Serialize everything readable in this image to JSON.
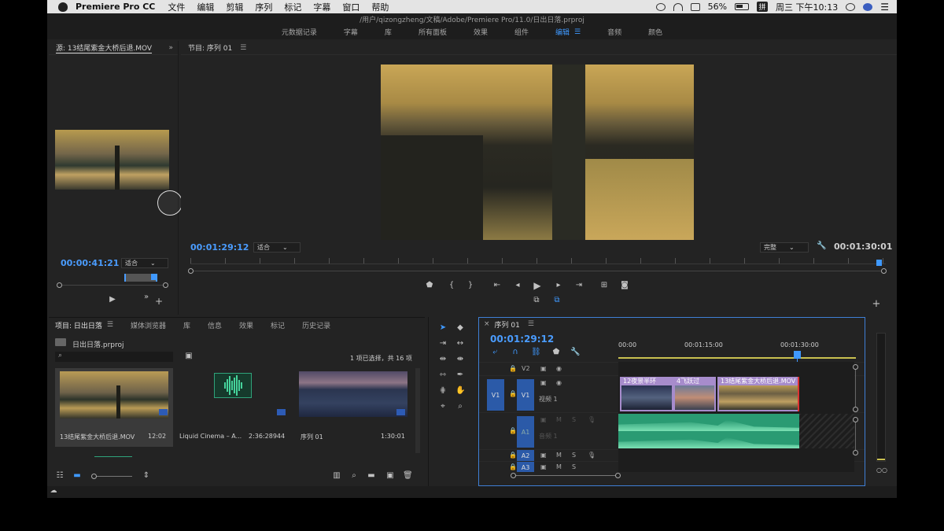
{
  "menubar": {
    "app_name": "Premiere Pro CC",
    "items": [
      "文件",
      "编辑",
      "剪辑",
      "序列",
      "标记",
      "字幕",
      "窗口",
      "帮助"
    ],
    "battery": "56%",
    "input_method": "拼",
    "clock": "周三 下午10:13"
  },
  "window": {
    "title": "/用户/qizongzheng/文稿/Adobe/Premiere Pro/11.0/日出日落.prproj"
  },
  "workspaces": {
    "tabs": [
      "元数据记录",
      "字幕",
      "库",
      "所有面板",
      "效果",
      "组件",
      "编辑",
      "音频",
      "颜色"
    ],
    "active": "编辑"
  },
  "source": {
    "title": "源: 13结尾紫金大桥后退.MOV",
    "timecode": "00:00:41:21",
    "fit": "适合"
  },
  "program": {
    "title": "节目: 序列 01",
    "timecode": "00:01:29:12",
    "fit": "适合",
    "quality": "完整",
    "duration": "00:01:30:01"
  },
  "project": {
    "tabs": [
      "项目: 日出日落",
      "媒体浏览器",
      "库",
      "信息",
      "效果",
      "标记",
      "历史记录"
    ],
    "file": "日出日落.prproj",
    "selection": "1 项已选择，共 16 项",
    "items": [
      {
        "name": "13结尾紫金大桥后退.MOV",
        "duration": "12:02"
      },
      {
        "name": "Liquid Cinema – A...",
        "duration": "2:36:28944"
      },
      {
        "name": "序列 01",
        "duration": "1:30:01"
      }
    ]
  },
  "timeline": {
    "title": "序列 01",
    "timecode": "00:01:29:12",
    "ruler": [
      "00:00",
      "00:01:15:00",
      "00:01:30:00"
    ],
    "tracks": {
      "v2": "V2",
      "v1": "V1",
      "v1_src": "V1",
      "v1_name": "视频 1",
      "a1": "A1",
      "a1_name": "音频 1",
      "a2": "A2",
      "a3": "A3",
      "m": "M",
      "s": "S"
    },
    "clips": [
      "12夜景半环",
      "4飞跃过",
      "13结尾紫金大桥后退.MOV"
    ]
  },
  "colors": {
    "accent": "#3f99ff",
    "video_clip": "#a78ccc",
    "audio_clip": "#2a9b73"
  }
}
